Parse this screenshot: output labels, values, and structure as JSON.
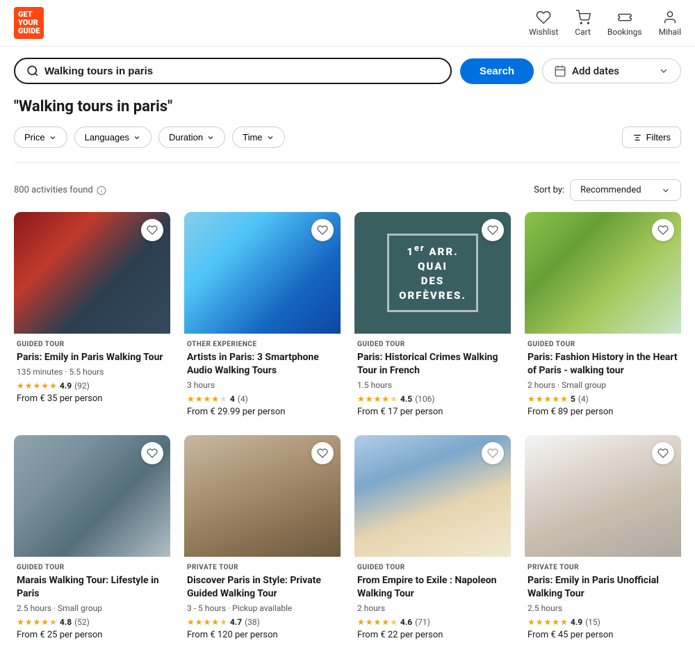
{
  "header": {
    "logo_line1": "GET",
    "logo_line2": "YOUR",
    "logo_line3": "GUIDE",
    "nav": [
      {
        "label": "Wishlist",
        "icon": "heart-icon"
      },
      {
        "label": "Cart",
        "icon": "cart-icon"
      },
      {
        "label": "Bookings",
        "icon": "ticket-icon"
      },
      {
        "label": "Mihail",
        "icon": "user-icon"
      }
    ]
  },
  "search": {
    "query": "Walking tours in paris",
    "search_btn": "Search",
    "date_placeholder": "Add dates"
  },
  "page_title": "\"Walking tours in paris\"",
  "filters": [
    {
      "label": "Price",
      "id": "price-filter"
    },
    {
      "label": "Languages",
      "id": "languages-filter"
    },
    {
      "label": "Duration",
      "id": "duration-filter"
    },
    {
      "label": "Time",
      "id": "time-filter"
    }
  ],
  "filters_btn": "Filters",
  "results": {
    "count": "800 activities found",
    "sort_label": "Sort by:",
    "sort_value": "Recommended"
  },
  "cards": [
    {
      "type": "GUIDED TOUR",
      "title": "Paris: Emily in Paris Walking Tour",
      "duration": "135 minutes · 5.5 hours",
      "rating": "4.9",
      "review_count": "(92)",
      "price": "From € 35 per person",
      "img_class": "img-1"
    },
    {
      "type": "OTHER EXPERIENCE",
      "title": "Artists in Paris: 3 Smartphone Audio Walking Tours",
      "duration": "3 hours",
      "rating": "4",
      "review_count": "(4)",
      "price": "From € 29.99 per person",
      "img_class": "img-2"
    },
    {
      "type": "GUIDED TOUR",
      "title": "Paris: Historical Crimes Walking Tour in French",
      "duration": "1.5 hours",
      "rating": "4.5",
      "review_count": "(106)",
      "price": "From € 17 per person",
      "img_class": "img-3"
    },
    {
      "type": "GUIDED TOUR",
      "title": "Paris: Fashion History in the Heart of Paris - walking tour",
      "duration": "2 hours · Small group",
      "rating": "5",
      "review_count": "(4)",
      "price": "From € 89 per person",
      "img_class": "img-4"
    },
    {
      "type": "GUIDED TOUR",
      "title": "Marais Walking Tour: Lifestyle in Paris",
      "duration": "2.5 hours · Small group",
      "rating": "4.8",
      "review_count": "(52)",
      "price": "From € 25 per person",
      "img_class": "img-5"
    },
    {
      "type": "PRIVATE TOUR",
      "title": "Discover Paris in Style: Private Guided Walking Tour",
      "duration": "3 - 5 hours · Pickup available",
      "rating": "4.7",
      "review_count": "(38)",
      "price": "From € 120 per person",
      "img_class": "img-6"
    },
    {
      "type": "GUIDED TOUR",
      "title": "From Empire to Exile : Napoleon Walking Tour",
      "duration": "2 hours",
      "rating": "4.6",
      "review_count": "(71)",
      "price": "From € 22 per person",
      "img_class": "img-7"
    },
    {
      "type": "PRIVATE TOUR",
      "title": "Paris: Emily in Paris Unofficial Walking Tour",
      "duration": "2.5 hours",
      "rating": "4.9",
      "review_count": "(15)",
      "price": "From € 45 per person",
      "img_class": "img-8"
    }
  ]
}
